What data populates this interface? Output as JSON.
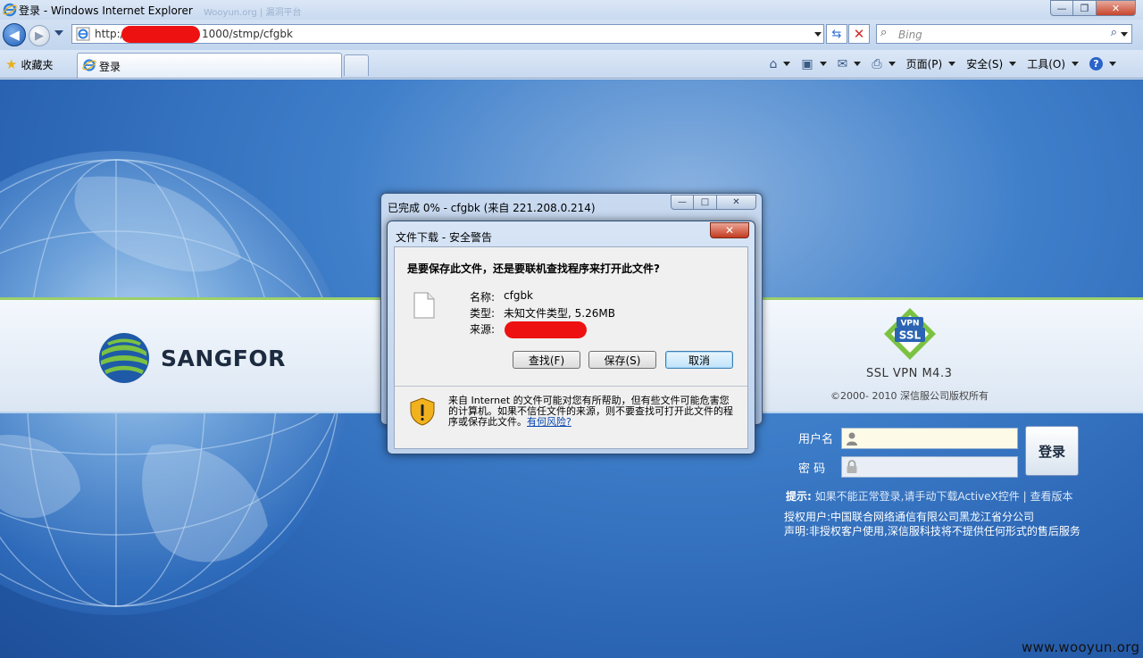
{
  "browser": {
    "window_title": "登录 - Windows Internet Explorer",
    "ghost_tab_text": "Wooyun.org | 漏洞平台",
    "url_prefix": "http://",
    "url_suffix": "1000/stmp/cfgbk",
    "search_placeholder": "Bing",
    "favorites_label": "收藏夹",
    "tab_label": "登录",
    "menu": {
      "page": "页面(P)",
      "safety": "安全(S)",
      "tools": "工具(O)"
    }
  },
  "download_window": {
    "title": "已完成 0% - cfgbk (来自 221.208.0.214)"
  },
  "dialog": {
    "title": "文件下载 - 安全警告",
    "question": "是要保存此文件，还是要联机查找程序来打开此文件?",
    "name_key": "名称:",
    "name_value": "cfgbk",
    "type_key": "类型:",
    "type_value": "未知文件类型, 5.26MB",
    "source_key": "来源:",
    "buttons": {
      "find": "查找(F)",
      "save": "保存(S)",
      "cancel": "取消"
    },
    "warning_text": "来自 Internet 的文件可能对您有所帮助，但有些文件可能危害您的计算机。如果不信任文件的来源，则不要查找可打开此文件的程序或保存此文件。",
    "risk_link": "有何风险?"
  },
  "page": {
    "logo_text": "SANGFOR",
    "vpn_badge_top": "VPN",
    "vpn_badge_bottom": "SSL",
    "product_title": "SSL VPN  M4.3",
    "copyright": "©2000- 2010   深信服公司版权所有",
    "username_label": "用户名",
    "password_label": "密  码",
    "login_button": "登录",
    "hint_label": "提示:",
    "hint_text": " 如果不能正常登录,请手动下载ActiveX控件  |  查看版本",
    "authorized_user": "授权用户:中国联合网络通信有限公司黑龙江省分公司",
    "declaration": "声明:非授权客户使用,深信服科技将不提供任何形式的售后服务",
    "watermark": "www.wooyun.org"
  }
}
